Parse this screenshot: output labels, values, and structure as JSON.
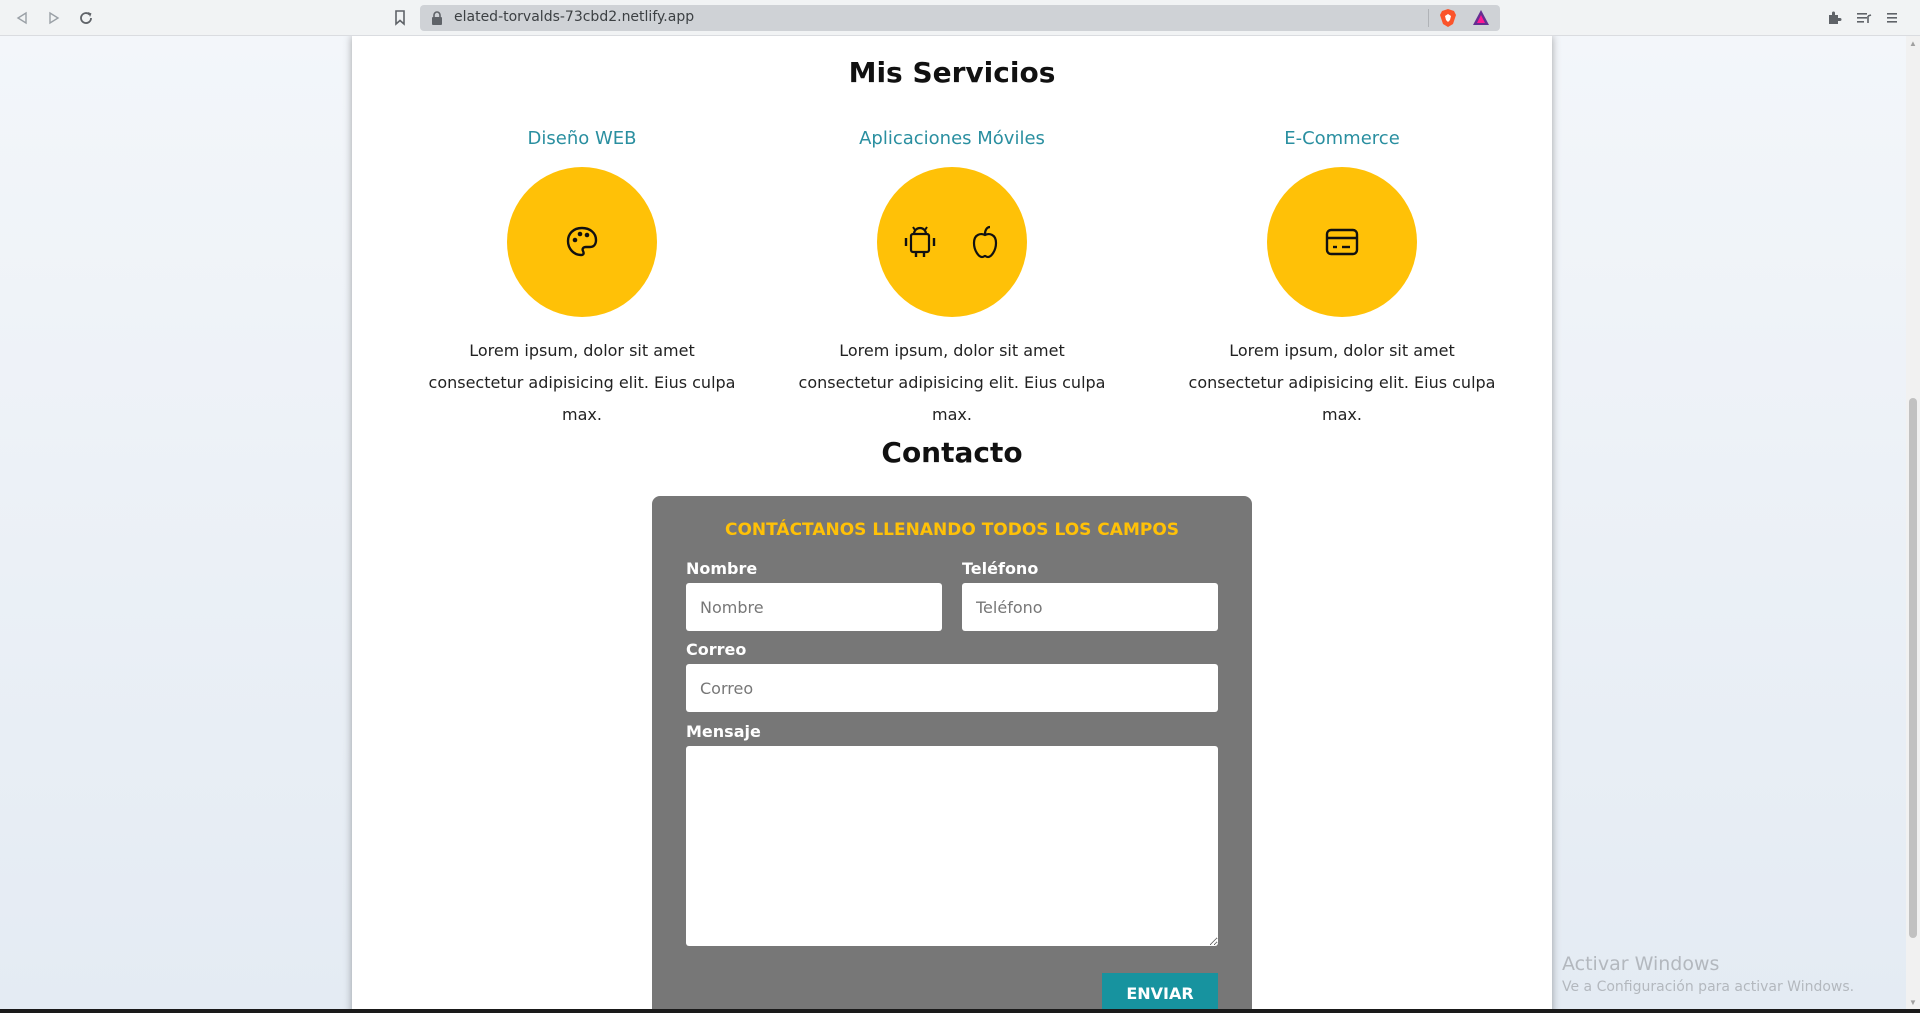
{
  "browser": {
    "url": "elated-torvalds-73cbd2.netlify.app",
    "icons": {
      "back": "back-arrow-icon",
      "forward": "forward-arrow-icon",
      "reload": "reload-icon",
      "bookmark": "bookmark-icon",
      "lock": "lock-icon",
      "brave": "brave-shield-icon",
      "rewards": "brave-rewards-icon",
      "extensions": "puzzle-icon",
      "playlist": "playlist-icon",
      "menu": "hamburger-menu-icon"
    }
  },
  "services": {
    "title": "Mis Servicios",
    "items": [
      {
        "heading": "Diseño WEB",
        "icon": "palette-icon",
        "text": "Lorem ipsum, dolor sit amet consectetur adipisicing elit. Eius culpa max."
      },
      {
        "heading": "Aplicaciones Móviles",
        "icons": [
          "android-icon",
          "apple-icon"
        ],
        "text": "Lorem ipsum, dolor sit amet consectetur adipisicing elit. Eius culpa max."
      },
      {
        "heading": "E-Commerce",
        "icon": "credit-card-icon",
        "text": "Lorem ipsum, dolor sit amet consectetur adipisicing elit. Eius culpa max."
      }
    ]
  },
  "contact": {
    "title": "Contacto",
    "form_heading": "CONTÁCTANOS LLENANDO TODOS LOS CAMPOS",
    "name_label": "Nombre",
    "name_placeholder": "Nombre",
    "phone_label": "Teléfono",
    "phone_placeholder": "Teléfono",
    "email_label": "Correo",
    "email_placeholder": "Correo",
    "message_label": "Mensaje",
    "submit_label": "ENVIAR"
  },
  "watermark": {
    "title": "Activar Windows",
    "subtitle": "Ve a Configuración para activar Windows."
  },
  "colors": {
    "accent_yellow": "#ffc107",
    "heading_teal": "#2a8fa0",
    "button_teal": "#17939f",
    "form_background": "#777777"
  }
}
